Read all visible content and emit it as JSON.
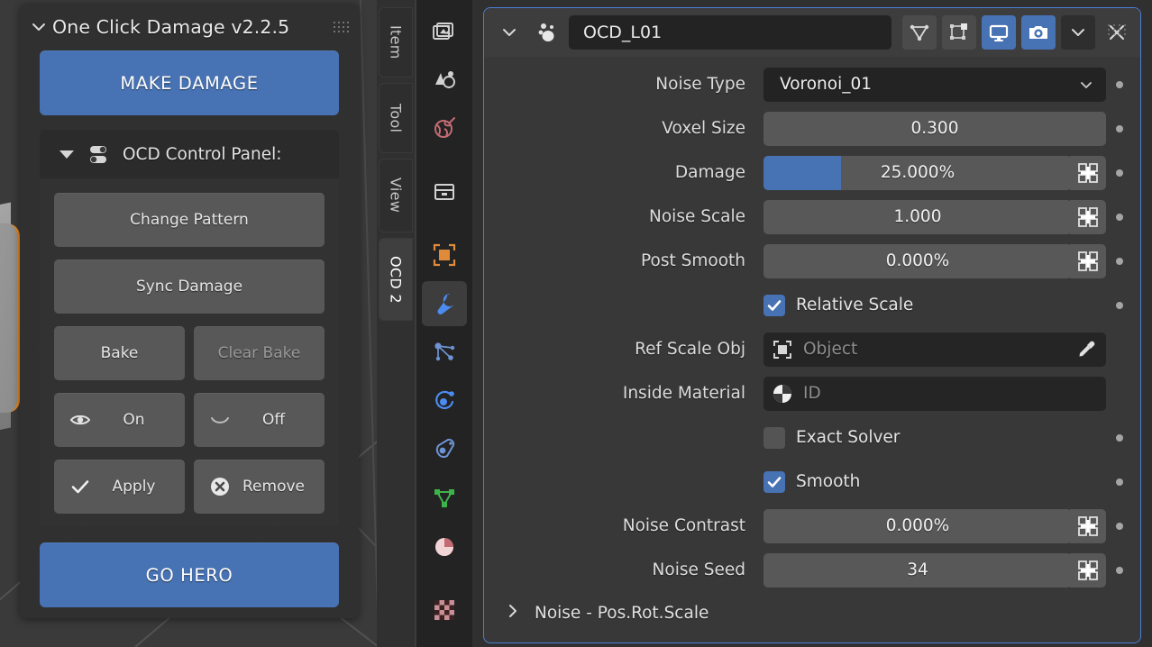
{
  "viewport": {
    "name": "3d-viewport",
    "selected_object_outline_color": "#e8861f",
    "background_color": "#3a3a3a"
  },
  "npanel": {
    "title": "One Click Damage v2.2.5",
    "collapse_icon": "chevron-down-icon",
    "grip_icon": "drag-grip-icon",
    "make_damage_label": "MAKE DAMAGE",
    "go_hero_label": "GO HERO",
    "control_panel": {
      "expand_icon": "triangle-down-icon",
      "preset_icon": "preset-toggle-icon",
      "title": "OCD Control Panel:",
      "change_pattern_label": "Change Pattern",
      "sync_damage_label": "Sync Damage",
      "bake_label": "Bake",
      "clear_bake_label": "Clear Bake",
      "clear_bake_disabled": true,
      "on_label": "On",
      "on_icon": "eye-open-icon",
      "off_label": "Off",
      "off_icon": "eye-closed-icon",
      "apply_label": "Apply",
      "apply_icon": "checkmark-icon",
      "remove_label": "Remove",
      "remove_icon": "x-circle-icon"
    }
  },
  "tabs": [
    {
      "label": "Item",
      "active": false
    },
    {
      "label": "Tool",
      "active": false
    },
    {
      "label": "View",
      "active": false
    },
    {
      "label": "OCD 2",
      "active": true
    }
  ],
  "property_tabs": [
    {
      "icon": "render-properties-icon",
      "active": false,
      "color": "#d0d0d0"
    },
    {
      "icon": "output-properties-icon",
      "active": false,
      "color": "#d0d0d0"
    },
    {
      "icon": "scene-properties-icon",
      "active": false,
      "color": "#c46a72"
    },
    {
      "icon": "view-layer-properties-icon",
      "active": false,
      "color": "#d0d0d0"
    },
    {
      "icon": "object-properties-icon",
      "active": false,
      "color": "#e08b3c"
    },
    {
      "icon": "modifier-properties-icon",
      "active": true,
      "color": "#4c8bf0"
    },
    {
      "icon": "particle-properties-icon",
      "active": false,
      "color": "#6d93d4"
    },
    {
      "icon": "physics-properties-icon",
      "active": false,
      "color": "#4c8bf0"
    },
    {
      "icon": "object-constraint-properties-icon",
      "active": false,
      "color": "#6d93d4"
    },
    {
      "icon": "mesh-data-properties-icon",
      "active": false,
      "color": "#3cb44a"
    },
    {
      "icon": "material-properties-icon",
      "active": false,
      "color": "#c46a72"
    },
    {
      "icon": "texture-properties-icon",
      "active": false,
      "color": "#c46a72"
    }
  ],
  "modifier": {
    "collapse_icon": "chevron-down-icon",
    "type_icon": "ocd-modifier-icon",
    "name": "OCD_L01",
    "toggles": [
      {
        "icon": "edit-mode-display-icon",
        "on": false
      },
      {
        "icon": "on-cage-display-icon",
        "on": false
      },
      {
        "icon": "realtime-display-icon",
        "on": true
      },
      {
        "icon": "render-display-icon",
        "on": true
      }
    ],
    "dropdown_icon": "chevron-down-icon",
    "close_icon": "close-x-icon",
    "grip_icon": "drag-grip-icon",
    "accent_border_color": "#4a7fd4",
    "rows": [
      {
        "kind": "dropdown",
        "label": "Noise Type",
        "value": "Voronoi_01",
        "decorator": "animate-dot-icon"
      },
      {
        "kind": "slider",
        "label": "Voxel Size",
        "value": "0.300",
        "fill_percent": 0,
        "lib_icon": false,
        "decorator": "animate-dot-icon"
      },
      {
        "kind": "slider",
        "label": "Damage",
        "value": "25.000%",
        "fill_percent": 25,
        "lib_icon": true,
        "decorator": "animate-dot-icon"
      },
      {
        "kind": "slider",
        "label": "Noise Scale",
        "value": "1.000",
        "fill_percent": 0,
        "lib_icon": true,
        "decorator": "animate-dot-icon"
      },
      {
        "kind": "slider",
        "label": "Post Smooth",
        "value": "0.000%",
        "fill_percent": 0,
        "lib_icon": true,
        "decorator": "animate-dot-icon"
      },
      {
        "kind": "checkbox",
        "label": "Relative Scale",
        "checked": true,
        "decorator": "animate-dot-icon"
      },
      {
        "kind": "object",
        "label": "Ref Scale Obj",
        "placeholder": "Object",
        "prefix_icon": "object-icon",
        "suffix_icon": "eyedropper-icon"
      },
      {
        "kind": "material",
        "label": "Inside Material",
        "placeholder": "ID",
        "prefix_icon": "material-sphere-icon"
      },
      {
        "kind": "checkbox",
        "label": "Exact Solver",
        "checked": false,
        "decorator": "animate-dot-icon"
      },
      {
        "kind": "checkbox",
        "label": "Smooth",
        "checked": true,
        "decorator": "animate-dot-icon"
      },
      {
        "kind": "slider",
        "label": "Noise Contrast",
        "value": "0.000%",
        "fill_percent": 0,
        "lib_icon": true,
        "decorator": "animate-dot-icon"
      },
      {
        "kind": "slider",
        "label": "Noise Seed",
        "value": "34",
        "fill_percent": 0,
        "lib_icon": true,
        "decorator": "animate-dot-icon"
      }
    ],
    "subpanel": {
      "expand_icon": "chevron-right-icon",
      "label": "Noise - Pos.Rot.Scale"
    }
  },
  "colors": {
    "accent_blue": "#4772b3",
    "panel_bg": "#303030",
    "field_grey": "#585858",
    "field_dark": "#232323",
    "select_orange": "#e8861f"
  }
}
